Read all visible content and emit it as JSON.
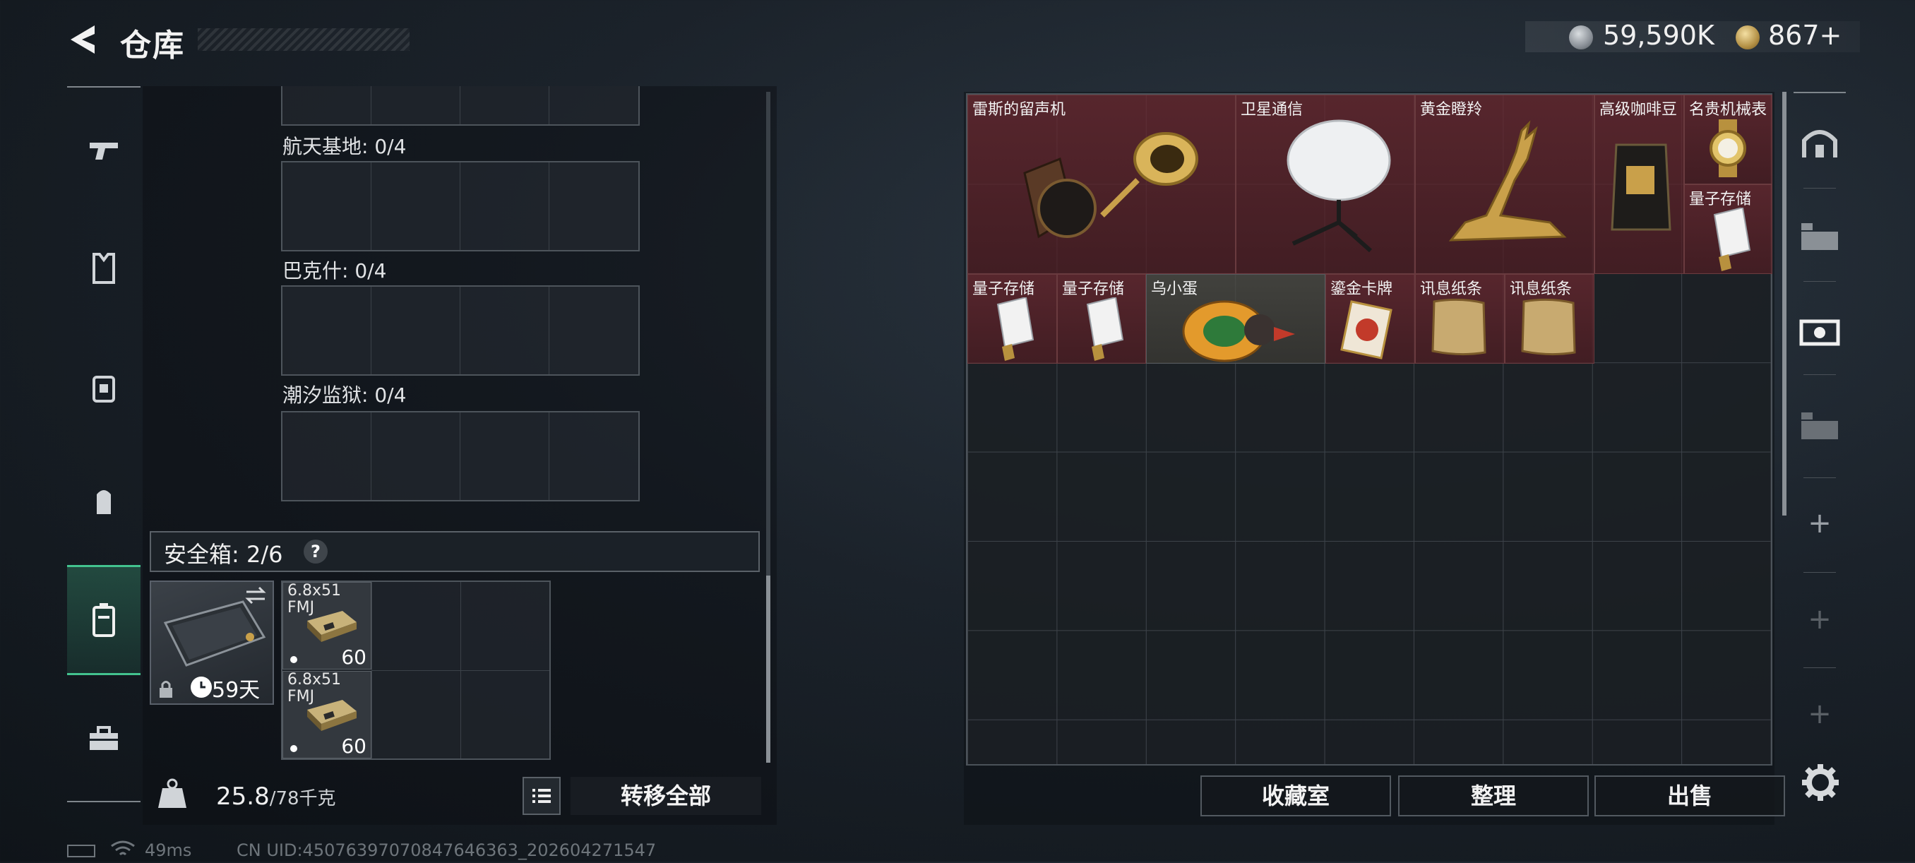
{
  "header": {
    "title": "仓库",
    "currency_silver": "59,590K",
    "currency_gold": "867",
    "currency_gold_add": "+"
  },
  "left_panel": {
    "groups": [
      {
        "label": "航天基地: 0/4"
      },
      {
        "label": "巴克什: 0/4"
      },
      {
        "label": "潮汐监狱: 0/4"
      }
    ],
    "safebox_label": "安全箱: 2/6",
    "help": "?",
    "case_days": "59天",
    "ammo": [
      {
        "name": "6.8x51 FMJ",
        "qty": "60"
      },
      {
        "name": "6.8x51 FMJ",
        "qty": "60"
      }
    ],
    "weight_current": "25.8",
    "weight_max": "/78千克",
    "transfer_all": "转移全部"
  },
  "stash_items": [
    {
      "name": "雷斯的留声机"
    },
    {
      "name": "卫星通信"
    },
    {
      "name": "黄金瞪羚"
    },
    {
      "name": "高级咖啡豆"
    },
    {
      "name": "名贵机械表"
    },
    {
      "name": "量子存储"
    },
    {
      "name": "量子存储"
    },
    {
      "name": "量子存储"
    },
    {
      "name": "乌小蛋"
    },
    {
      "name": "鎏金卡牌"
    },
    {
      "name": "讯息纸条"
    },
    {
      "name": "讯息纸条"
    }
  ],
  "bottom_buttons": {
    "collection": "收藏室",
    "sort": "整理",
    "sell": "出售"
  },
  "status": {
    "ping": "49ms",
    "uid": "CN UID:4507639707084764636​3_202604271547"
  },
  "colors": {
    "accent_green": "#43c38f",
    "item_red": "#6e2830",
    "item_gold": "#b49146"
  }
}
